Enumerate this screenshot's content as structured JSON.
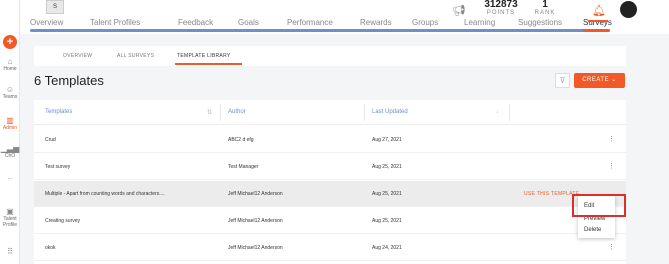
{
  "sidebar": {
    "items": [
      {
        "label": "Home"
      },
      {
        "label": "Teams"
      },
      {
        "label": "Admin"
      },
      {
        "label": "ChO"
      },
      {
        "label": "..."
      },
      {
        "label": "Talent Profile"
      },
      {
        "label": ""
      }
    ],
    "accent": "#f05a28"
  },
  "nav": {
    "tabs": [
      "Overview",
      "Talent Profiles",
      "Feedback",
      "Goals",
      "Performance",
      "Rewards",
      "Groups",
      "Learning",
      "Suggestions",
      "Surveys"
    ],
    "active": "Surveys"
  },
  "header": {
    "points_value": "312873",
    "points_label": "POINTS",
    "rank_value": "1",
    "rank_label": "RANK"
  },
  "subtabs": {
    "items": [
      "OVERVIEW",
      "ALL SURVEYS",
      "TEMPLATE LIBRARY"
    ],
    "active": "TEMPLATE LIBRARY"
  },
  "page": {
    "title": "6 Templates",
    "create_label": "CREATE"
  },
  "table": {
    "columns": [
      "Templates",
      "Author",
      "Last Updated"
    ],
    "rows": [
      {
        "name": "Crud",
        "author": "ABC2 d efg",
        "updated": "Aug 27, 2021"
      },
      {
        "name": "Test survey",
        "author": "Test Manager",
        "updated": "Aug 25, 2021"
      },
      {
        "name": "Multiple - Apart from counting words and characters....",
        "author": "Jeff Michael12 Anderson",
        "updated": "Aug 25, 2021",
        "action": "USE THIS TEMPLATE"
      },
      {
        "name": "Creating survey",
        "author": "Jeff Michael12 Anderson",
        "updated": "Aug 25, 2021"
      },
      {
        "name": "okok",
        "author": "Jeff Michael12 Anderson",
        "updated": "Aug 24, 2021"
      }
    ]
  },
  "menu": {
    "items": [
      "Edit",
      "Preview",
      "Delete"
    ]
  }
}
